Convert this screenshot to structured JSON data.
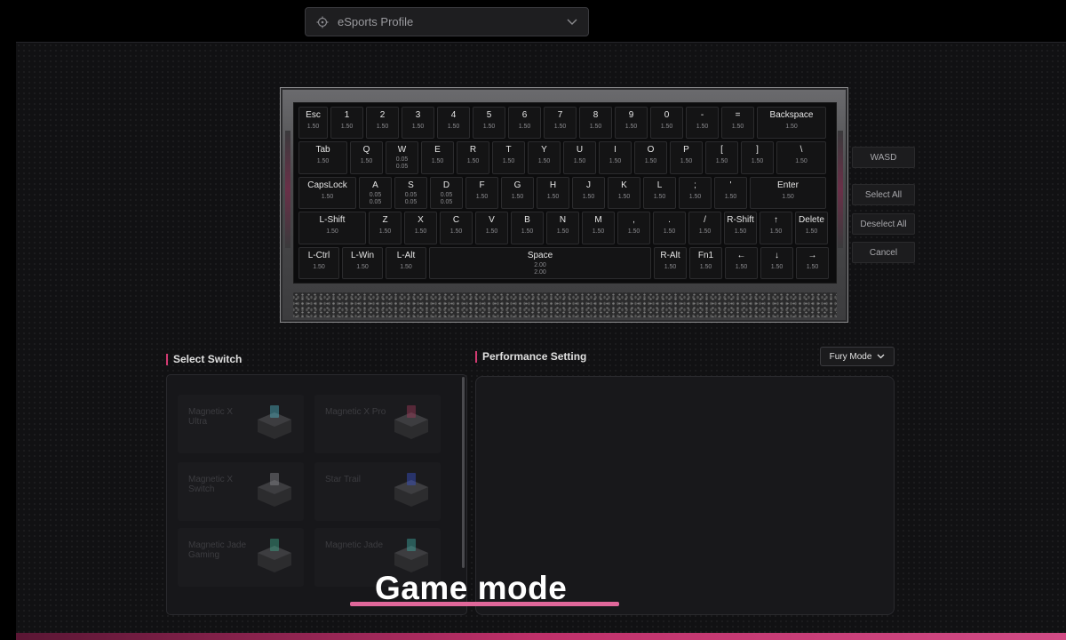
{
  "profile": {
    "label": "eSports Profile"
  },
  "keyboard": {
    "rows": [
      [
        {
          "label": "Esc",
          "v": "1.50",
          "w": 33
        },
        {
          "label": "1",
          "v": "1.50",
          "w": 37
        },
        {
          "label": "2",
          "v": "1.50",
          "w": 37
        },
        {
          "label": "3",
          "v": "1.50",
          "w": 37
        },
        {
          "label": "4",
          "v": "1.50",
          "w": 37
        },
        {
          "label": "5",
          "v": "1.50",
          "w": 37
        },
        {
          "label": "6",
          "v": "1.50",
          "w": 37
        },
        {
          "label": "7",
          "v": "1.50",
          "w": 37
        },
        {
          "label": "8",
          "v": "1.50",
          "w": 37
        },
        {
          "label": "9",
          "v": "1.50",
          "w": 37
        },
        {
          "label": "0",
          "v": "1.50",
          "w": 37
        },
        {
          "label": "-",
          "v": "1.50",
          "w": 37
        },
        {
          "label": "=",
          "v": "1.50",
          "w": 37
        },
        {
          "label": "Backspace",
          "v": "1.50",
          "w": 78
        }
      ],
      [
        {
          "label": "Tab",
          "v": "1.50",
          "w": 55
        },
        {
          "label": "Q",
          "v": "1.50",
          "w": 37
        },
        {
          "label": "W",
          "v": "0.05",
          "v2": "0.05",
          "w": 37
        },
        {
          "label": "E",
          "v": "1.50",
          "w": 37
        },
        {
          "label": "R",
          "v": "1.50",
          "w": 37
        },
        {
          "label": "T",
          "v": "1.50",
          "w": 37
        },
        {
          "label": "Y",
          "v": "1.50",
          "w": 37
        },
        {
          "label": "U",
          "v": "1.50",
          "w": 37
        },
        {
          "label": "I",
          "v": "1.50",
          "w": 37
        },
        {
          "label": "O",
          "v": "1.50",
          "w": 37
        },
        {
          "label": "P",
          "v": "1.50",
          "w": 37
        },
        {
          "label": "[",
          "v": "1.50",
          "w": 37
        },
        {
          "label": "]",
          "v": "1.50",
          "w": 37
        },
        {
          "label": "\\",
          "v": "1.50",
          "w": 56
        }
      ],
      [
        {
          "label": "CapsLock",
          "v": "1.50",
          "w": 65
        },
        {
          "label": "A",
          "v": "0.05",
          "v2": "0.05",
          "w": 37
        },
        {
          "label": "S",
          "v": "0.05",
          "v2": "0.05",
          "w": 37
        },
        {
          "label": "D",
          "v": "0.05",
          "v2": "0.05",
          "w": 37
        },
        {
          "label": "F",
          "v": "1.50",
          "w": 37
        },
        {
          "label": "G",
          "v": "1.50",
          "w": 37
        },
        {
          "label": "H",
          "v": "1.50",
          "w": 37
        },
        {
          "label": "J",
          "v": "1.50",
          "w": 37
        },
        {
          "label": "K",
          "v": "1.50",
          "w": 37
        },
        {
          "label": "L",
          "v": "1.50",
          "w": 37
        },
        {
          "label": ";",
          "v": "1.50",
          "w": 37
        },
        {
          "label": "'",
          "v": "1.50",
          "w": 37
        },
        {
          "label": "Enter",
          "v": "1.50",
          "w": 86
        }
      ],
      [
        {
          "label": "L-Shift",
          "v": "1.50",
          "w": 76
        },
        {
          "label": "Z",
          "v": "1.50",
          "w": 37
        },
        {
          "label": "X",
          "v": "1.50",
          "w": 37
        },
        {
          "label": "C",
          "v": "1.50",
          "w": 37
        },
        {
          "label": "V",
          "v": "1.50",
          "w": 37
        },
        {
          "label": "B",
          "v": "1.50",
          "w": 37
        },
        {
          "label": "N",
          "v": "1.50",
          "w": 37
        },
        {
          "label": "M",
          "v": "1.50",
          "w": 37
        },
        {
          "label": ",",
          "v": "1.50",
          "w": 37
        },
        {
          "label": ".",
          "v": "1.50",
          "w": 37
        },
        {
          "label": "/",
          "v": "1.50",
          "w": 37
        },
        {
          "label": "R-Shift",
          "v": "1.50",
          "w": 37
        },
        {
          "label": "↑",
          "v": "1.50",
          "w": 37
        },
        {
          "label": "Delete",
          "v": "1.50",
          "w": 37
        }
      ],
      [
        {
          "label": "L-Ctrl",
          "v": "1.50",
          "w": 46
        },
        {
          "label": "L-Win",
          "v": "1.50",
          "w": 46
        },
        {
          "label": "L-Alt",
          "v": "1.50",
          "w": 46
        },
        {
          "label": "Space",
          "v": "2.00",
          "v2": "2.00",
          "w": 250
        },
        {
          "label": "R-Alt",
          "v": "1.50",
          "w": 37
        },
        {
          "label": "Fn1",
          "v": "1.50",
          "w": 37
        },
        {
          "label": "←",
          "v": "1.50",
          "w": 37
        },
        {
          "label": "↓",
          "v": "1.50",
          "w": 37
        },
        {
          "label": "→",
          "v": "1.50",
          "w": 37
        }
      ]
    ]
  },
  "side_buttons": {
    "wasd": "WASD",
    "select_all": "Select All",
    "deselect_all": "Deselect All",
    "cancel": "Cancel"
  },
  "select_switch": {
    "title": "Select Switch",
    "switches": [
      {
        "name": "Magnetic X Ultra",
        "color": "#4fb3c4"
      },
      {
        "name": "Magnetic X Pro",
        "color": "#a03a58"
      },
      {
        "name": "Magnetic X Switch",
        "color": "#8a8a8e"
      },
      {
        "name": "Star Trail",
        "color": "#3a52c8"
      },
      {
        "name": "Magnetic Jade Gaming",
        "color": "#3fa88a"
      },
      {
        "name": "Magnetic Jade",
        "color": "#3fa8a0"
      }
    ]
  },
  "performance": {
    "title": "Performance Setting",
    "mode": "Fury Mode"
  },
  "caption": "Game mode"
}
